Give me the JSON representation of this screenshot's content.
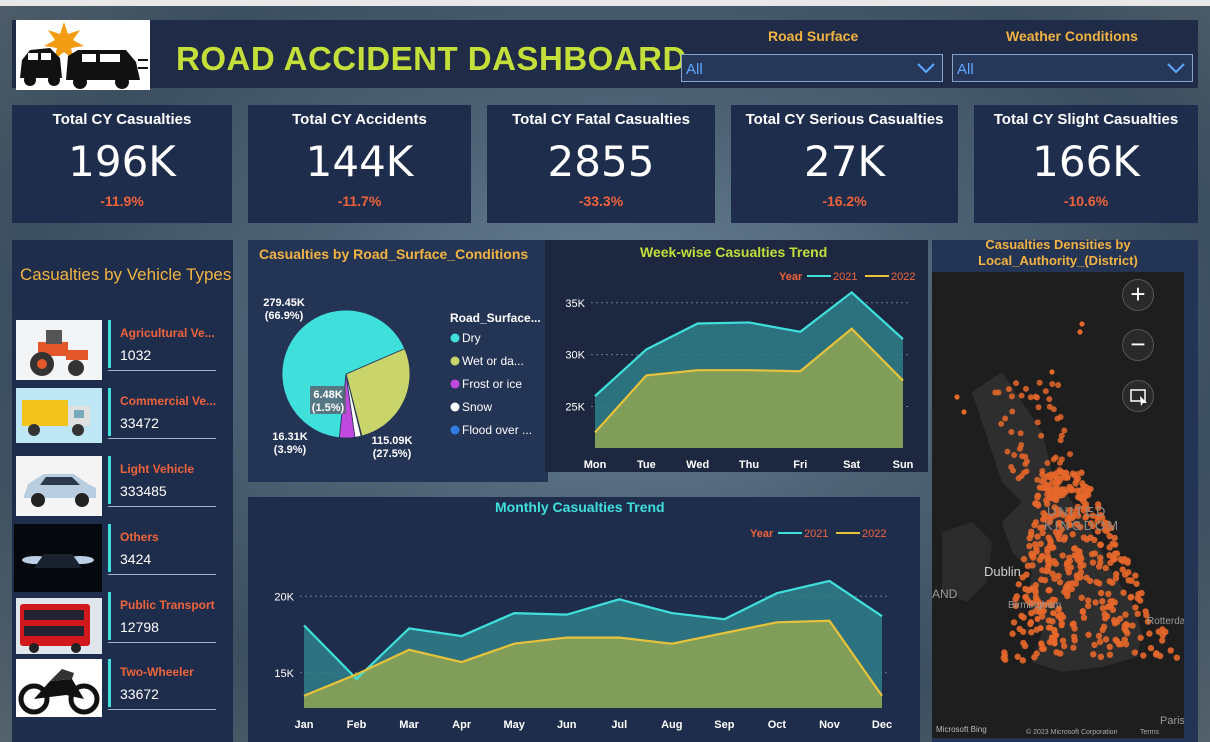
{
  "header": {
    "title": "ROAD ACCIDENT DASHBOARD"
  },
  "slicers": [
    {
      "label": "Road Surface",
      "value": "All"
    },
    {
      "label": "Weather Conditions",
      "value": "All"
    }
  ],
  "kpis": [
    {
      "label": "Total CY Casualties",
      "value": "196K",
      "change": "-11.9%"
    },
    {
      "label": "Total CY Accidents",
      "value": "144K",
      "change": "-11.7%"
    },
    {
      "label": "Total CY Fatal Casualties",
      "value": "2855",
      "change": "-33.3%"
    },
    {
      "label": "Total CY Serious Casualties",
      "value": "27K",
      "change": "-16.2%"
    },
    {
      "label": "Total CY Slight Casualties",
      "value": "166K",
      "change": "-10.6%"
    }
  ],
  "vehicles": {
    "title": "Casualties  by Vehicle Types",
    "items": [
      {
        "label": "Agricultural Ve...",
        "value": "1032",
        "icon": "tractor-image"
      },
      {
        "label": "Commercial Ve...",
        "value": "33472",
        "icon": "truck-image"
      },
      {
        "label": "Light Vehicle",
        "value": "333485",
        "icon": "car-image"
      },
      {
        "label": "Others",
        "value": "3424",
        "icon": "headlights-image"
      },
      {
        "label": "Public Transport",
        "value": "12798",
        "icon": "bus-image"
      },
      {
        "label": "Two-Wheeler",
        "value": "33672",
        "icon": "motorcycle-image"
      }
    ]
  },
  "map": {
    "title_line1": "Casualties Densities by",
    "title_line2": "Local_Authority_(District)",
    "labels": [
      "UNITED",
      "KINGDOM",
      "Dublin",
      "Birmingham",
      "AND",
      "Rotterdam",
      "Paris"
    ],
    "credit": "Microsoft Bing",
    "copyright": "© 2023 Microsoft Corporation",
    "terms": "Terms"
  },
  "colors": {
    "y2021": "#3fe0dc",
    "y2022": "#e8c23a",
    "accent": "#f3b340",
    "negative": "#f0633a",
    "title": "#c5df3a"
  },
  "chart_data": [
    {
      "type": "pie",
      "title": "Casualties by Road_Surface_Conditions",
      "legend_title": "Road_Surface...",
      "slices": [
        {
          "name": "Dry",
          "value": 279.45,
          "label": "279.45K",
          "pct": "(66.9%)",
          "color": "#3fe0dc"
        },
        {
          "name": "Wet or da...",
          "value": 115.09,
          "label": "115.09K",
          "pct": "(27.5%)",
          "color": "#c9d46a"
        },
        {
          "name": "Frost or ice",
          "value": 16.31,
          "label": "16.31K",
          "pct": "(3.9%)",
          "color": "#c04ae0"
        },
        {
          "name": "Snow",
          "value": 6.48,
          "label": "6.48K",
          "pct": "(1.5%)",
          "color": "#ffffff"
        },
        {
          "name": "Flood over ...",
          "value": 0.8,
          "label": "",
          "pct": "",
          "color": "#2f7de0"
        }
      ]
    },
    {
      "type": "area",
      "title": "Week-wise Casualties Trend",
      "legend_title": "Year",
      "categories": [
        "Mon",
        "Tue",
        "Wed",
        "Thu",
        "Fri",
        "Sat",
        "Sun"
      ],
      "yticks": [
        "25K",
        "30K",
        "35K"
      ],
      "ylim": [
        21000,
        37000
      ],
      "series": [
        {
          "name": "2021",
          "values": [
            26000,
            30500,
            33000,
            33100,
            32200,
            36000,
            31500
          ]
        },
        {
          "name": "2022",
          "values": [
            22500,
            28000,
            28500,
            28500,
            28400,
            32500,
            27500
          ]
        }
      ]
    },
    {
      "type": "area",
      "title": "Monthly Casualties Trend",
      "legend_title": "Year",
      "categories": [
        "Jan",
        "Feb",
        "Mar",
        "Apr",
        "May",
        "Jun",
        "Jul",
        "Aug",
        "Sep",
        "Oct",
        "Nov",
        "Dec"
      ],
      "yticks": [
        "15K",
        "20K"
      ],
      "ylim": [
        12700,
        22500
      ],
      "series": [
        {
          "name": "2021",
          "values": [
            18100,
            14600,
            17900,
            17400,
            18900,
            18800,
            19800,
            18900,
            18500,
            20200,
            21000,
            18700
          ]
        },
        {
          "name": "2022",
          "values": [
            13500,
            14900,
            16500,
            15700,
            16900,
            17300,
            17300,
            16900,
            17600,
            18300,
            18400,
            13500
          ]
        }
      ]
    }
  ]
}
